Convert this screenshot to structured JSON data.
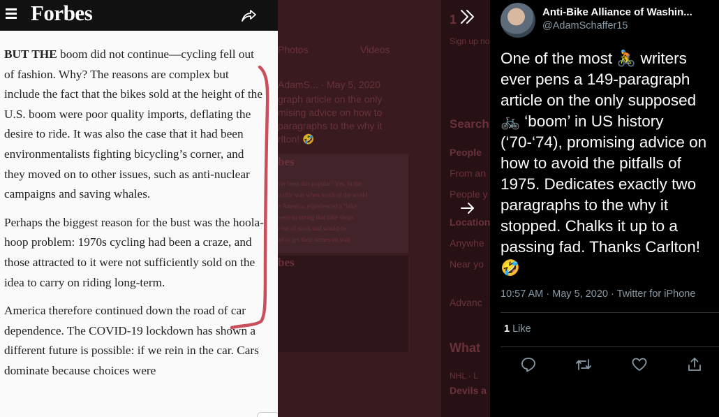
{
  "forbes": {
    "logo": "Forbes",
    "paragraphs": [
      {
        "lead": "BUT THE",
        "text": " boom did not continue—cycling fell out of fashion. Why? The reasons are complex but include the fact that the bikes sold at the height of the U.S. boom were poor quality imports, deflating the desire to ride. It was also the case that it had been environmentalists fighting bicycling’s corner, and they moved on to other issues, such as anti-nuclear campaigns and saving whales."
      },
      {
        "text": "Perhaps the biggest reason for the bust was the hoola-hoop problem: 1970s cycling had been a craze, and those attracted to it were not sufficiently sold on the idea to carry on riding long-term."
      },
      {
        "text": "America therefore continued down the road of car dependence. The COVID-19 lockdown has shown a different future is possible: if we rein in the car. Cars dominate because choices were"
      }
    ],
    "annotation_color": "#c8505d"
  },
  "background": {
    "tabs": [
      "Photos",
      "Videos"
    ],
    "tweet_meta": "AdamS...  · May 5, 2020",
    "tweet_lines": [
      "graph article on the only",
      "mising advice on how to",
      "paragraphs to the why it",
      "rlton! 🤣"
    ],
    "embed_logo": "bes",
    "embed_lines": [
      "ver been this popular? Yes. In the",
      "traffic was when much of the world",
      "n America, experienced a “bike",
      "were so strong that bike shops",
      "t out of stock and would-be",
      "ad to get their names on wait"
    ],
    "embed_logo2": "bes",
    "side_letters": "1",
    "side_items": [
      "Sign up no",
      "Search",
      "People",
      "From an",
      "People y",
      "Location",
      "Anywhe",
      "Near yo",
      "Advanc",
      "What",
      "NHL · L",
      "Devils a"
    ]
  },
  "tweet": {
    "display_name": "Anti-Bike Alliance of Washin...",
    "handle": "@AdamSchaffer15",
    "text": "One of the most 🚴 writers ever pens a 149-paragraph article on the only supposed 🚲 ‘boom’ in US history (‘70-‘74), promising advice on how to avoid the pitfalls of 1975. Dedicates exactly two paragraphs to the why it stopped. Chalks it up to a passing fad. Thanks Carlton! 🤣",
    "time": "10:57 AM · May 5, 2020",
    "separator": " · ",
    "source": "Twitter for iPhone",
    "like_count": "1",
    "like_label": " Like"
  },
  "icons": {
    "menu": "hamburger-icon",
    "share": "share-arrow-icon",
    "collapse": "double-chevron-right-icon",
    "next": "arrow-right-icon",
    "reply": "reply-icon",
    "retweet": "retweet-icon",
    "like": "heart-icon",
    "share_tweet": "share-upload-icon"
  },
  "colors": {
    "accent_mark": "#c8505d",
    "tweet_bg": "#000000",
    "muted": "#8899a6"
  }
}
